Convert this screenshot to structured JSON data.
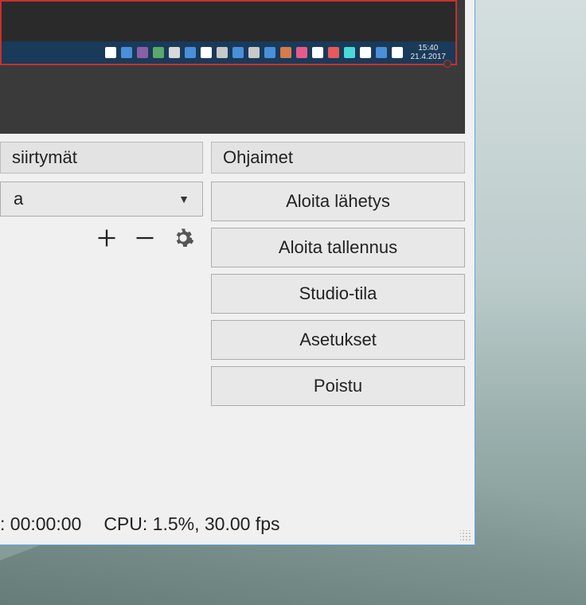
{
  "preview": {
    "taskbar": {
      "clock_time": "15:40",
      "clock_date": "21.4.2017",
      "tray_colors": [
        "#ffffff",
        "#4a8fd8",
        "#8b5fa8",
        "#5aa86a",
        "#d8d8d8",
        "#4a8fd8",
        "#ffffff",
        "#c8c8c8",
        "#4a8fd8",
        "#c8c8c8",
        "#4a8fd8",
        "#d87a4a",
        "#e85a8a",
        "#ffffff",
        "#e85a5a",
        "#4ad8d8",
        "#ffffff",
        "#4a8fd8",
        "#ffffff"
      ]
    }
  },
  "panels": {
    "transitions": {
      "title": "siirtymät",
      "selected": "a"
    },
    "controls": {
      "title": "Ohjaimet",
      "buttons": {
        "start_stream": "Aloita lähetys",
        "start_recording": "Aloita tallennus",
        "studio_mode": "Studio-tila",
        "settings": "Asetukset",
        "exit": "Poistu"
      }
    }
  },
  "status": {
    "time": ": 00:00:00",
    "cpu": "CPU: 1.5%, 30.00 fps"
  },
  "icons": {
    "plus": "plus-icon",
    "minus": "minus-icon",
    "gear": "gear-icon"
  }
}
